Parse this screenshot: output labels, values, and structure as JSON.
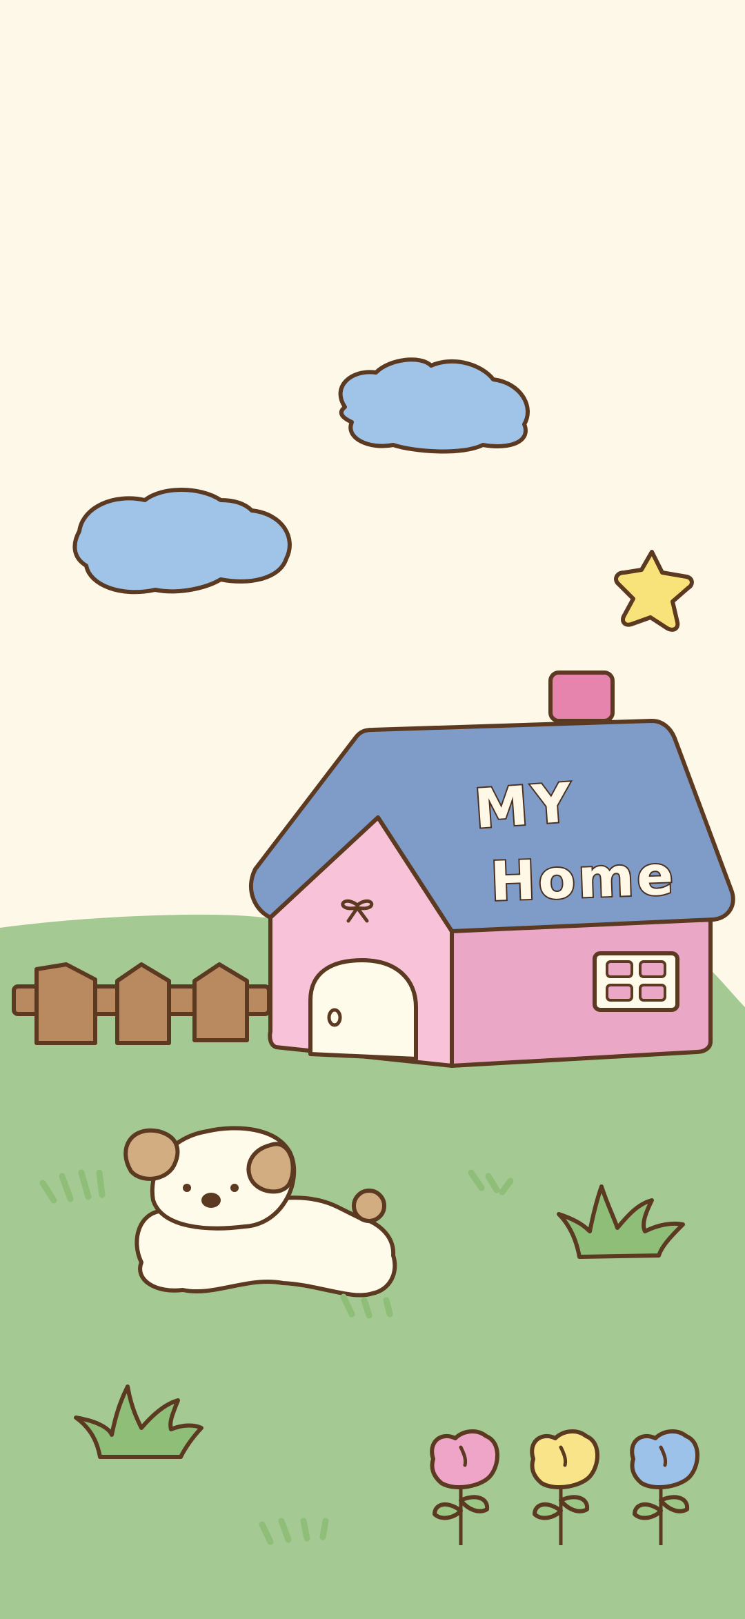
{
  "roof_sign": {
    "line1": "MY",
    "line2": "Home"
  },
  "colors": {
    "sky": "#FDF8E8",
    "grass": "#A4C992",
    "outline": "#5C3A22",
    "cloud": "#9FC4E8",
    "star": "#F8E27A",
    "roof": "#7F9BC8",
    "house_front": "#F8C3D8",
    "house_side": "#EBA8C6",
    "chimney": "#E784AE",
    "door": "#FFFBEB",
    "fence": "#B98A60",
    "dog_body": "#FFFBEB",
    "dog_ears": "#D3AD82",
    "tuft": "#8FBE78",
    "flower_pink": "#EFA5C8",
    "flower_yellow": "#F9E48A",
    "flower_blue": "#9DC2EA",
    "flower_stem": "#9CC784"
  },
  "icons": [
    "cloud-icon",
    "star-icon",
    "house-icon",
    "fence-icon",
    "dog-icon",
    "grass-tuft-icon",
    "tulip-icon"
  ]
}
